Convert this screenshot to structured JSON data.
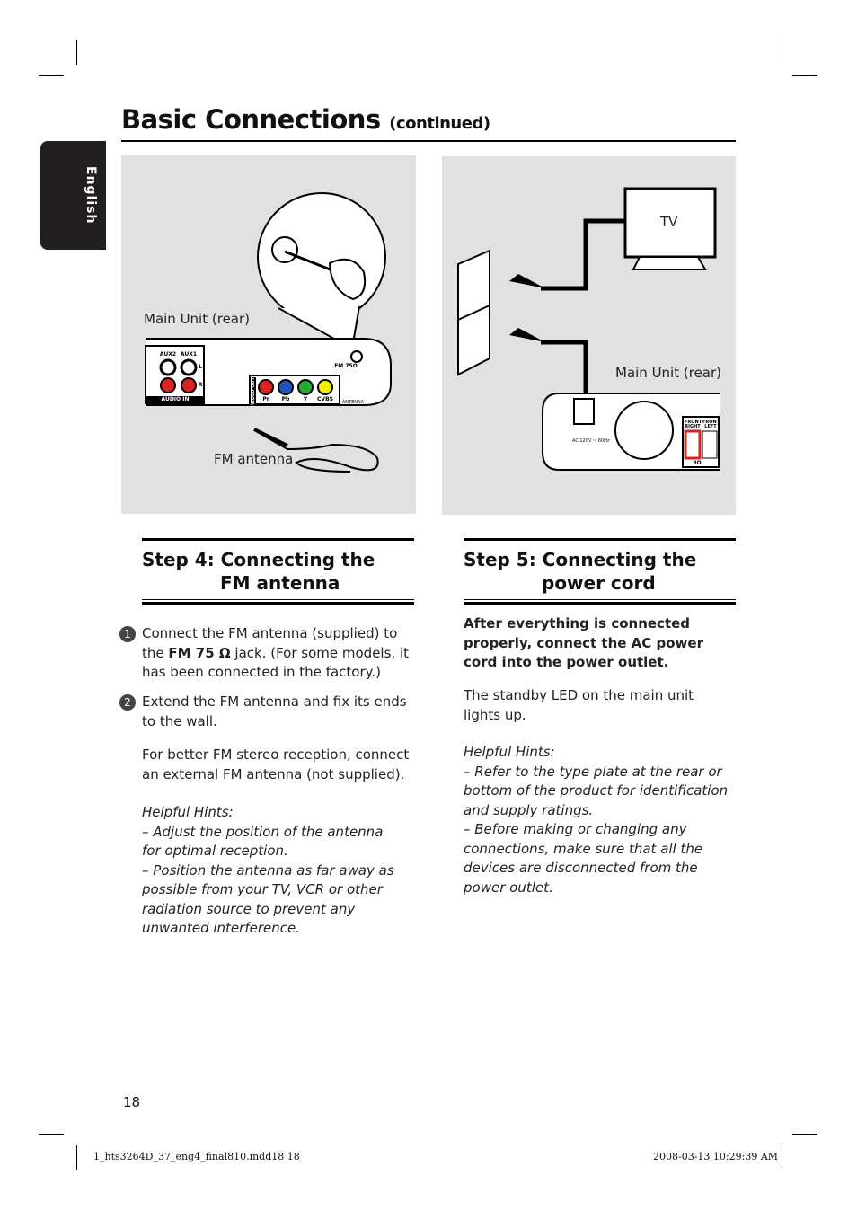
{
  "header": {
    "title": "Basic Connections",
    "subtitle": "(continued)"
  },
  "side_tab": "English",
  "left_figure": {
    "main_unit_label": "Main Unit (rear)",
    "antenna_label": "FM antenna",
    "jacks": [
      "AUX2",
      "AUX1",
      "L",
      "R",
      "AUDIO IN",
      "VIDEO OUT",
      "Pr",
      "Pb",
      "Y",
      "CVBS",
      "FM 75Ω",
      "ANTENNA"
    ]
  },
  "right_figure": {
    "tv_label": "TV",
    "main_unit_label": "Main Unit (rear)",
    "power_rating": "AC 120V ~ 60Hz",
    "speakers": [
      "FRONT RIGHT",
      "FRONT LEFT",
      "3Ω"
    ]
  },
  "step4": {
    "heading_line1": "Step 4:   Connecting the",
    "heading_line2": "FM antenna",
    "item1_a": "Connect the FM antenna (supplied) to the ",
    "item1_bold": "FM 75 Ω",
    "item1_b": " jack. (For some models, it has been connected in the factory.)",
    "item2": "Extend the FM antenna and fix its ends to the wall.",
    "note": "For better FM stereo reception, connect an external FM antenna (not supplied).",
    "hints_title": "Helpful Hints:",
    "hint1": "–  Adjust the position of the antenna for optimal reception.",
    "hint2": "–  Position the antenna as far away as possible from your TV, VCR or other radiation source to prevent any unwanted interference."
  },
  "step5": {
    "heading_line1": "Step 5:   Connecting the",
    "heading_line2": "power cord",
    "intro_bold": "After everything is connected properly, connect the AC power cord into the power outlet.",
    "text": "The standby LED on the main unit lights up.",
    "hints_title": "Helpful Hints:",
    "hint1": "–  Refer to the type plate at the rear or bottom of the product for identification and supply ratings.",
    "hint2": "–  Before making or changing any connections, make sure that all the devices are disconnected from the power outlet."
  },
  "footer": {
    "page_number": "18",
    "file": "1_hts3264D_37_eng4_final810.indd18   18",
    "timestamp": "2008-03-13   10:29:39 AM"
  }
}
